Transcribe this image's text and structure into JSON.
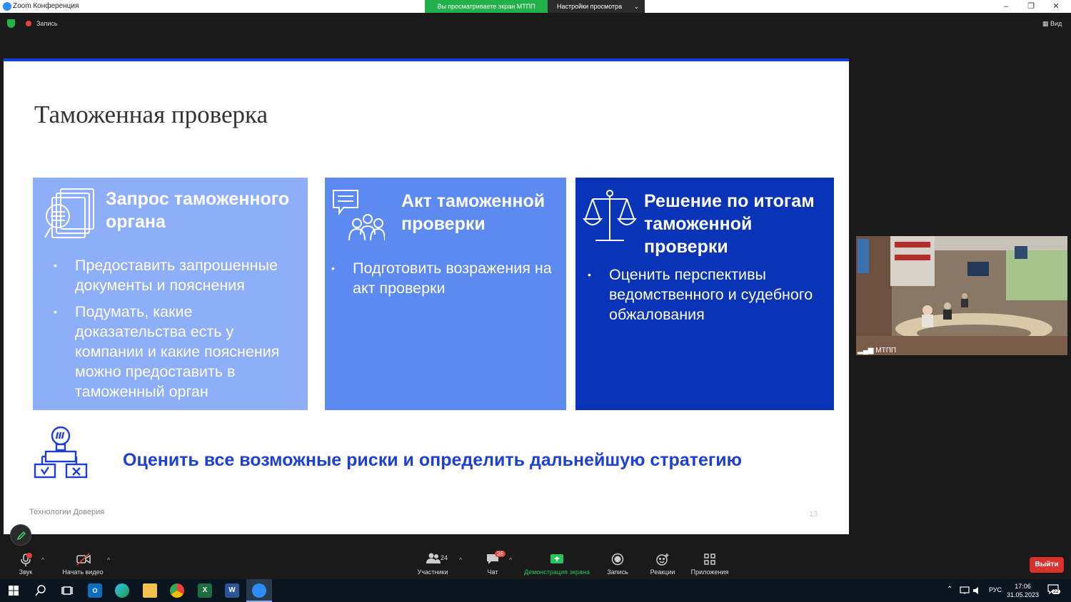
{
  "window": {
    "title": "Zoom Конференция",
    "minimize": "–",
    "restore": "❐",
    "close": "✕"
  },
  "share_banner": {
    "text": "Вы просматриваете экран МТПП",
    "view_settings": "Настройки просмотра",
    "chevron": "⌄"
  },
  "topbar": {
    "record_label": "Запись",
    "view_label": "Вид"
  },
  "slide": {
    "title": "Таможенная проверка",
    "cards": [
      {
        "heading": "Запрос таможенного органа",
        "bullets": [
          "Предоставить запрошенные документы и пояснения",
          "Подумать, какие доказательства есть у компании и какие пояснения можно предоставить в таможенный орган"
        ],
        "icon": "documents-icon"
      },
      {
        "heading": "Акт таможенной проверки",
        "bullets": [
          "Подготовить возражения на акт проверки"
        ],
        "icon": "discussion-group-icon"
      },
      {
        "heading": "Решение по итогам таможенной проверки",
        "bullets": [
          "Оценить перспективы ведомственного и судебного обжалования"
        ],
        "icon": "scales-icon"
      }
    ],
    "bottom_text": "Оценить все возможные риски и определить дальнейшую стратегию",
    "footer": "Технологии Доверия",
    "page_number": "13"
  },
  "video_tile": {
    "name": "МТПП"
  },
  "toolbar": {
    "audio": "Звук",
    "video": "Начать видео",
    "participants": "Участники",
    "participants_count": "24",
    "chat": "Чат",
    "chat_badge": "36",
    "share": "Демонстрация экрана",
    "record": "Запись",
    "reactions": "Реакции",
    "apps": "Приложения",
    "end": "Выйти"
  },
  "taskbar": {
    "lang": "РУС",
    "time": "17:06",
    "date": "31.05.2023",
    "notifications": "22"
  },
  "colors": {
    "accent": "#1240d6",
    "card1": "#8faefa",
    "card2": "#5c8af0",
    "card3": "#0a34b8",
    "share_green": "#22b04a",
    "end_red": "#d9312d"
  }
}
